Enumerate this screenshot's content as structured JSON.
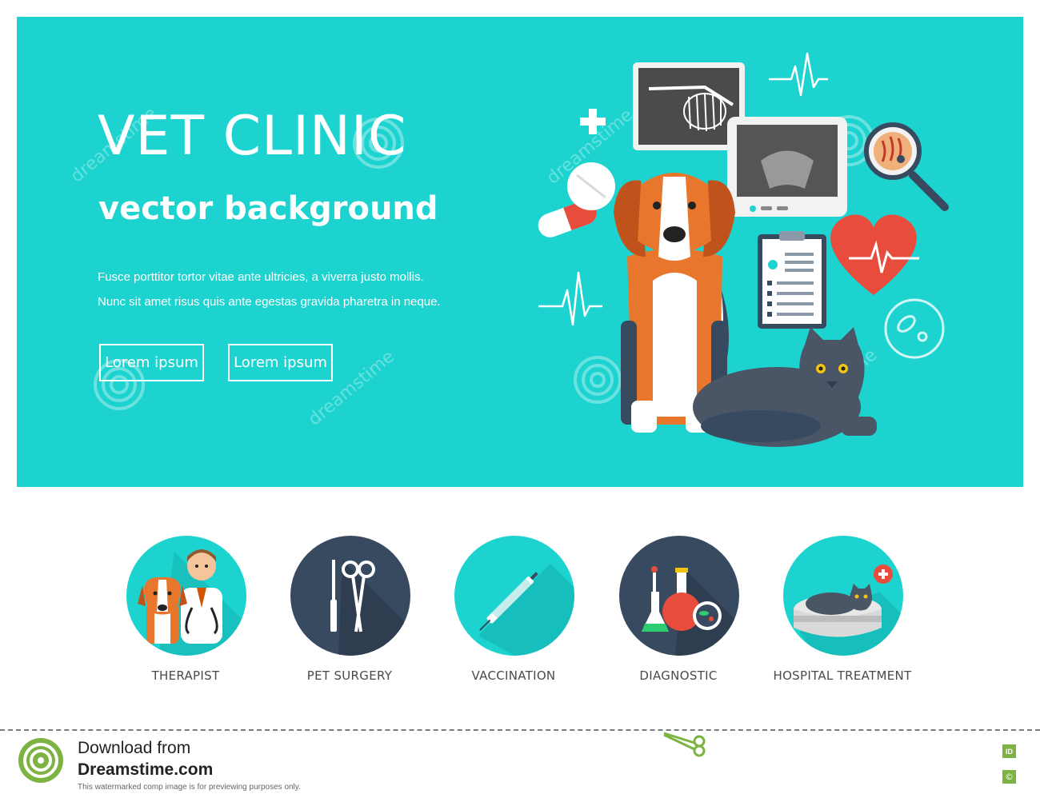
{
  "hero": {
    "title": "VET CLINIC",
    "subtitle": "vector background",
    "body_line1": "Fusce porttitor tortor vitae ante ultricies, a viverra justo mollis.",
    "body_line2": "Nunc sit amet risus quis ante egestas gravida pharetra in neque.",
    "button1_label": "Lorem ipsum",
    "button2_label": "Lorem ipsum",
    "background_color": "#1dd3cf"
  },
  "services": [
    {
      "label": "THERAPIST",
      "icon": "therapist-icon",
      "circle_color": "#1dd3cf"
    },
    {
      "label": "PET SURGERY",
      "icon": "scissors-icon",
      "circle_color": "#384a5f"
    },
    {
      "label": "VACCINATION",
      "icon": "syringe-icon",
      "circle_color": "#1dd3cf"
    },
    {
      "label": "DIAGNOSTIC",
      "icon": "lab-flask-icon",
      "circle_color": "#384a5f"
    },
    {
      "label": "HOSPITAL TREATMENT",
      "icon": "cat-bed-icon",
      "circle_color": "#1dd3cf"
    }
  ],
  "watermark": {
    "text": "dreamstime"
  },
  "footer": {
    "download_text": "Download from",
    "site_name": "Dreamstime.com",
    "note": "This watermarked comp image is for previewing purposes only.",
    "id_badge": "ID",
    "copyright_badge": "©",
    "accent_color": "#7cb342"
  }
}
